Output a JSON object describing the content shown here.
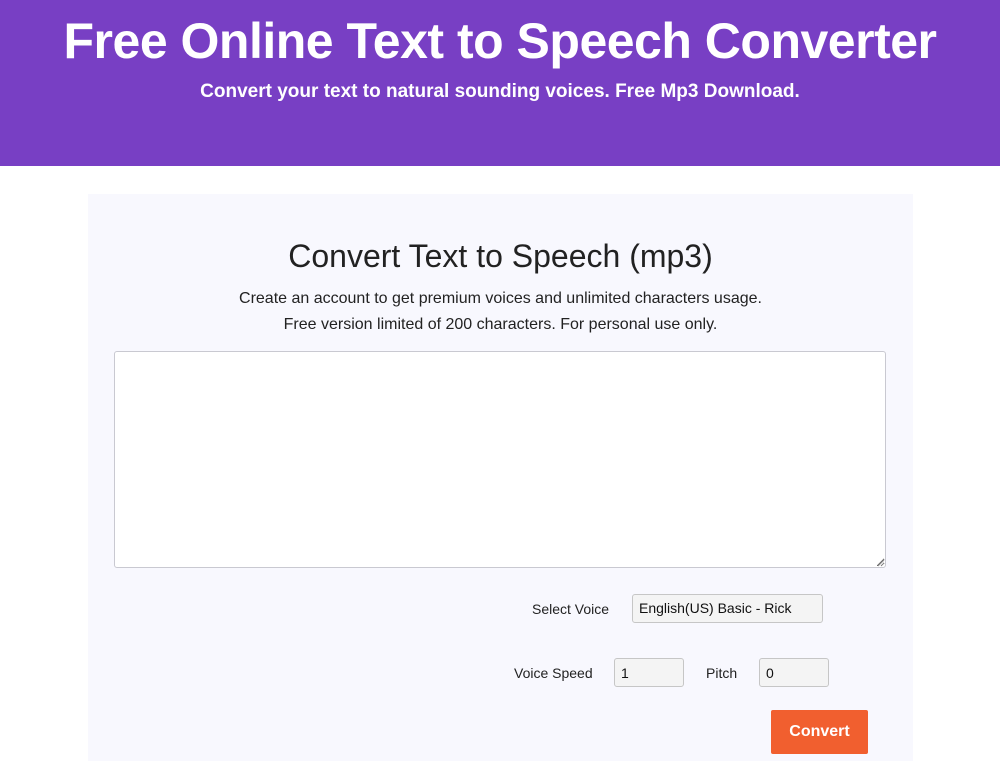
{
  "header": {
    "title": "Free Online Text to Speech Converter",
    "subtitle": "Convert your text to natural sounding voices. Free Mp3 Download.",
    "background_color": "#783fc4"
  },
  "converter": {
    "title": "Convert Text to Speech (mp3)",
    "description_line1": "Create an account to get premium voices and unlimited characters usage.",
    "description_line2": "Free version limited of 200 characters. For personal use only.",
    "text_value": "",
    "voice_label": "Select Voice",
    "voice_selected": "English(US) Basic - Rick",
    "speed_label": "Voice Speed",
    "speed_value": "1",
    "pitch_label": "Pitch",
    "pitch_value": "0",
    "convert_label": "Convert",
    "button_color": "#f15f2f",
    "icons": [
      "resize-grip-icon"
    ]
  }
}
